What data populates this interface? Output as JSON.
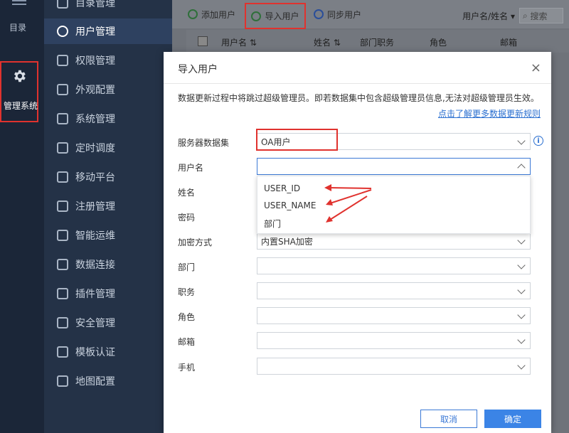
{
  "rail": {
    "directory_label": "目录",
    "admin_label": "管理系统"
  },
  "nav": {
    "items": [
      {
        "label": "目录管理"
      },
      {
        "label": "用户管理"
      },
      {
        "label": "权限管理"
      },
      {
        "label": "外观配置"
      },
      {
        "label": "系统管理"
      },
      {
        "label": "定时调度"
      },
      {
        "label": "移动平台"
      },
      {
        "label": "注册管理"
      },
      {
        "label": "智能运维"
      },
      {
        "label": "数据连接"
      },
      {
        "label": "插件管理"
      },
      {
        "label": "安全管理"
      },
      {
        "label": "模板认证"
      },
      {
        "label": "地图配置"
      }
    ]
  },
  "toolbar": {
    "add_user": "添加用户",
    "import_user": "导入用户",
    "sync_user": "同步用户",
    "filter": "用户名/姓名",
    "search_placeholder": "搜索"
  },
  "table": {
    "columns": [
      "用户名",
      "姓名",
      "部门职务",
      "角色",
      "邮箱"
    ]
  },
  "dialog": {
    "title": "导入用户",
    "note": "数据更新过程中将跳过超级管理员。即若数据集中包含超级管理员信息,无法对超级管理员生效。",
    "rule_link": "点击了解更多数据更新规则",
    "fields": {
      "server_dataset": {
        "label": "服务器数据集",
        "value": "OA用户"
      },
      "username": {
        "label": "用户名",
        "value": ""
      },
      "name": {
        "label": "姓名"
      },
      "password": {
        "label": "密码"
      },
      "encryption": {
        "label": "加密方式",
        "value": "内置SHA加密"
      },
      "department": {
        "label": "部门",
        "value": ""
      },
      "position": {
        "label": "职务",
        "value": ""
      },
      "role": {
        "label": "角色",
        "value": ""
      },
      "email": {
        "label": "邮箱",
        "value": ""
      },
      "phone": {
        "label": "手机",
        "value": ""
      }
    },
    "dropdown_options": [
      "USER_ID",
      "USER_NAME",
      "部门"
    ],
    "cancel": "取消",
    "ok": "确定"
  },
  "colors": {
    "accent": "#3b84e6",
    "highlight": "#e0322e"
  }
}
